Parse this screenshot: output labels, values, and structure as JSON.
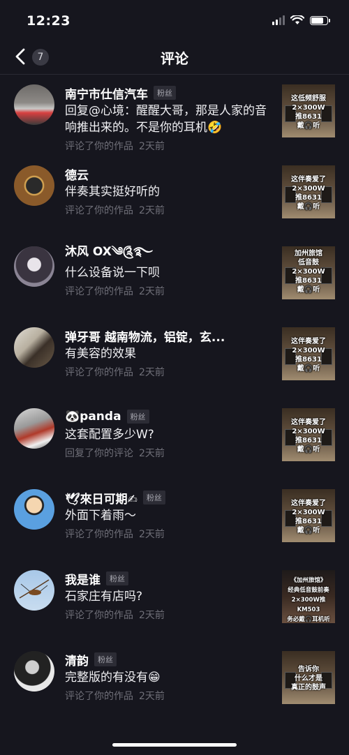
{
  "status": {
    "time": "12:23"
  },
  "nav": {
    "back_count": "7",
    "title": "评论"
  },
  "colors": {
    "background": "#16161e",
    "badge_bg": "#2c2c35",
    "meta_text": "#6f6f78"
  },
  "comments": [
    {
      "name": "南宁市仕信汽车",
      "badge": "粉丝",
      "text": "回复@心境：醒醒大哥，那是人家的音响推出来的。不是你的耳机🤣",
      "action": "评论了你的作品",
      "time": "2天前",
      "thumb": "这低频舒服\n2×300W\n推8631\n戴🎧听"
    },
    {
      "name": "德云",
      "badge": "",
      "text": "伴奏其实挺好听的",
      "action": "评论了你的作品",
      "time": "2天前",
      "thumb": "这伴奏爱了\n2×300W\n推8631\n戴🎧听"
    },
    {
      "name": "沐风 OX༄༊࿐",
      "badge": "",
      "text": "什么设备说一下呗",
      "action": "评论了你的作品",
      "time": "2天前",
      "thumb": "加州旅馆\n低音鼓\n2×300W\n推8631\n戴🎧听"
    },
    {
      "name": "弹牙哥  越南物流，铝锭，玄...",
      "badge": "",
      "text": "有美容的效果",
      "action": "评论了你的作品",
      "time": "2天前",
      "thumb": "这伴奏爱了\n2×300W\n推8631\n戴🎧听"
    },
    {
      "name": "🐼panda",
      "badge": "粉丝",
      "text": "这套配置多少W?",
      "action": "回复了你的评论",
      "time": "2天前",
      "thumb": "这伴奏爱了\n2×300W\n推8631\n戴🎧听"
    },
    {
      "name": "🕊來日可期✍",
      "badge": "粉丝",
      "text": "外面下着雨～",
      "action": "评论了你的作品",
      "time": "2天前",
      "thumb": "这伴奏爱了\n2×300W\n推8631\n戴🎧听"
    },
    {
      "name": "我是谁",
      "badge": "粉丝",
      "text": "石家庄有店吗?",
      "action": "评论了你的作品",
      "time": "2天前",
      "thumb": "《加州旅馆》\n经典低音鼓前奏\n2×300W推KM503\n务必戴🎧耳机听"
    },
    {
      "name": "清韵",
      "badge": "粉丝",
      "text": "完整版的有没有😁",
      "action": "评论了你的作品",
      "time": "2天前",
      "thumb": "告诉你\n什么才是\n真正的鼓声"
    }
  ]
}
